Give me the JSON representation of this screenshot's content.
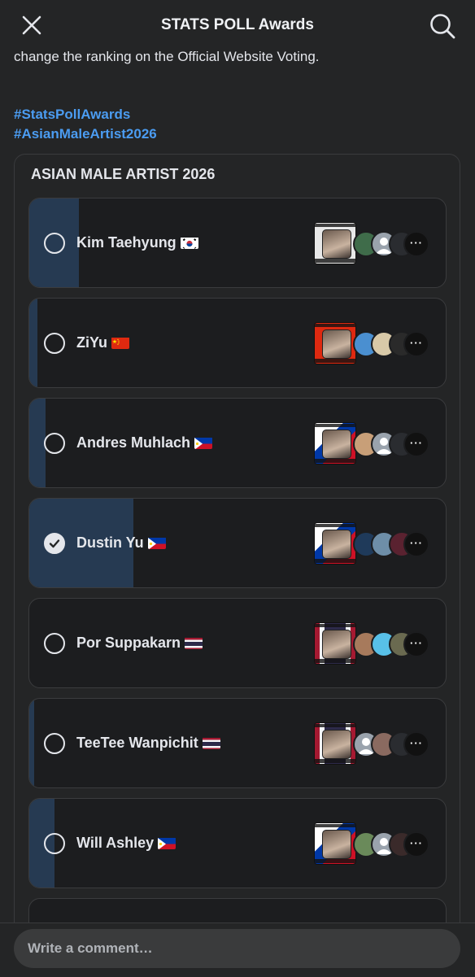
{
  "header": {
    "title": "STATS POLL Awards"
  },
  "post": {
    "text": "change the ranking on the Official Website Voting.",
    "hashtags": [
      "#StatsPollAwards",
      "#AsianMaleArtist2026"
    ]
  },
  "poll": {
    "title": "ASIAN MALE ARTIST 2026",
    "options": [
      {
        "name": "Kim Taehyung",
        "flag": "kr",
        "share": 0.12,
        "selected": false
      },
      {
        "name": "ZiYu",
        "flag": "cn",
        "share": 0.02,
        "selected": false
      },
      {
        "name": "Andres Muhlach",
        "flag": "ph",
        "share": 0.04,
        "selected": false
      },
      {
        "name": "Dustin Yu",
        "flag": "ph",
        "share": 0.25,
        "selected": true
      },
      {
        "name": "Por Suppakarn",
        "flag": "th",
        "share": 0.0,
        "selected": false
      },
      {
        "name": "TeeTee Wanpichit",
        "flag": "th",
        "share": 0.01,
        "selected": false
      },
      {
        "name": "Will Ashley",
        "flag": "ph",
        "share": 0.06,
        "selected": false
      }
    ],
    "more_voters_label": "···"
  },
  "comment": {
    "placeholder": "Write a comment…"
  },
  "colors": {
    "accent": "#4b9cf1",
    "bar_fill": "#263a52",
    "background": "#242526"
  }
}
